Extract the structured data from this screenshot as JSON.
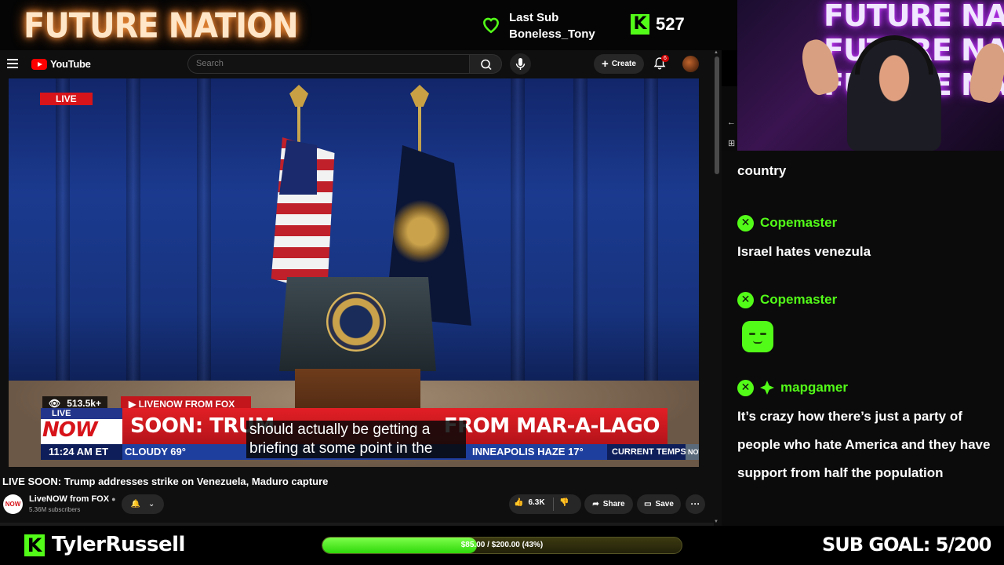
{
  "overlay": {
    "stream_title": "FUTURE NATION",
    "last_sub_label": "Last Sub",
    "last_sub_user": "Boneless_Tony",
    "kick_icon": "K",
    "follower_count": "527",
    "accent_color": "#53fc18"
  },
  "youtube": {
    "logo_text": "YouTube",
    "search_placeholder": "Search",
    "create_label": "Create",
    "notification_count": "6",
    "video": {
      "live_label": "LIVE",
      "viewers": "513.5k+",
      "source_label": "LIVENOW FROM FOX",
      "live_small": "LIVE",
      "now_label": "NOW",
      "headline_left": "SOON: TRUM",
      "headline_right": "FROM MAR-A-LAGO",
      "time": "11:24 AM ET",
      "weather_left": "CLOUDY 69°",
      "weather_right": "INNEAPOLIS  HAZE 17°",
      "current_temps": "CURRENT TEMPS",
      "now_logo": "NOW",
      "caption": "should actually be getting a briefing at some point in the"
    },
    "title": "LIVE SOON: Trump addresses strike on Venezuela, Maduro capture",
    "channel": {
      "name": "LiveNOW from FOX",
      "subscribers": "5.36M subscribers",
      "avatar_text": "NOW"
    },
    "likes": "6.3K",
    "share_label": "Share",
    "save_label": "Save"
  },
  "webcam": {
    "neon_line1": "FUTURE NATION",
    "neon_line2": "FUTURE NATION",
    "neon_line3": "FUTURE NATION"
  },
  "chat": {
    "cutoff_text": "country",
    "messages": [
      {
        "user": "Copemaster",
        "text": "Israel hates venezula",
        "badges": [
          "x-badge"
        ]
      },
      {
        "user": "Copemaster",
        "text": "",
        "emote": "green-face-emote",
        "badges": [
          "x-badge"
        ]
      },
      {
        "user": "mapgamer",
        "text": "It’s crazy how there’s just a party of people who hate America and they have support from half the population",
        "badges": [
          "x-badge",
          "diamond-badge"
        ]
      }
    ],
    "badge_glyph": "✕"
  },
  "bottom": {
    "kick_icon": "K",
    "streamer_name": "TylerRussell",
    "goal_text": "$85.00 / $200.00 (43%)",
    "goal_fraction": 0.43,
    "sub_goal": "SUB GOAL: 5/200"
  }
}
